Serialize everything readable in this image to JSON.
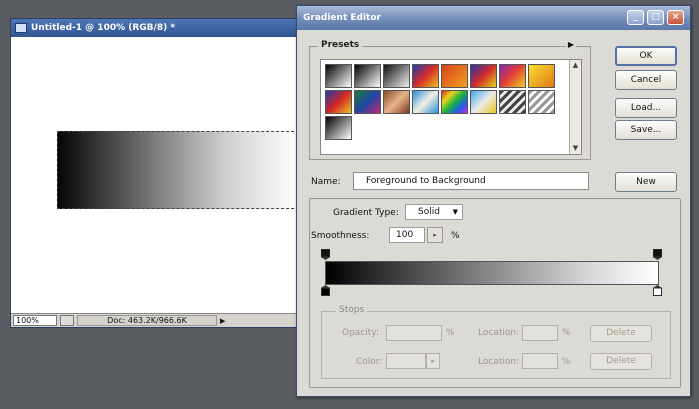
{
  "document": {
    "title": "Untitled-1 @ 100% (RGB/8) *",
    "zoom": "100%",
    "doc_info": "Doc: 463.2K/966.6K"
  },
  "dialog": {
    "title": "Gradient Editor",
    "presets_label": "Presets",
    "buttons": {
      "ok": "OK",
      "cancel": "Cancel",
      "load": "Load...",
      "save": "Save...",
      "new": "New"
    },
    "name_label": "Name:",
    "name_value": "Foreground to Background",
    "gradient_type_label": "Gradient Type:",
    "gradient_type_value": "Solid",
    "smoothness_label": "Smoothness:",
    "smoothness_value": "100",
    "smoothness_unit": "%",
    "stops": {
      "label": "Stops",
      "opacity_label": "Opacity:",
      "color_label": "Color:",
      "location_label": "Location:",
      "percent": "%",
      "delete_label": "Delete"
    }
  },
  "colors": {
    "title_bar": "#5a78aa",
    "dialog_bg": "#dcdad4"
  },
  "presets": [
    "linear-gradient(135deg,#000,#fff)",
    "linear-gradient(135deg,#000 0%,#fff 100%)",
    "linear-gradient(135deg,#111,#eee)",
    "linear-gradient(135deg,#1a3ea8,#d82a2a 50%,#e8c21a)",
    "linear-gradient(135deg,#d6441c,#f4a020)",
    "linear-gradient(135deg,#2636a6,#d12b2b 50%,#e4d21e)",
    "linear-gradient(135deg,#7a2fb0,#e23a3a 45%,#f0cf23)",
    "linear-gradient(135deg,#f7e02e,#e17a1a)",
    "linear-gradient(135deg,#223aa6,#d42626,#e8c52a)",
    "linear-gradient(135deg,#1e7d3a,#1e47a3,#c0287a)",
    "linear-gradient(135deg,#8a4a2a,#e8b48a,#7a3a1e)",
    "linear-gradient(135deg,#2a8fd8,#f2efe2,#2a8fd8)",
    "linear-gradient(135deg,#e2281e,#e8d41e,#1eb33a,#1e5fe8,#c81ee8)",
    "linear-gradient(135deg,#3aa6e8,#eaeaea,#e8c81e)",
    "repeating-linear-gradient(135deg,#444 0 3px,#eee 3px 6px)",
    "repeating-linear-gradient(135deg,#999 0 3px,#fff 3px 6px)",
    "linear-gradient(135deg,#000,#fff)"
  ]
}
